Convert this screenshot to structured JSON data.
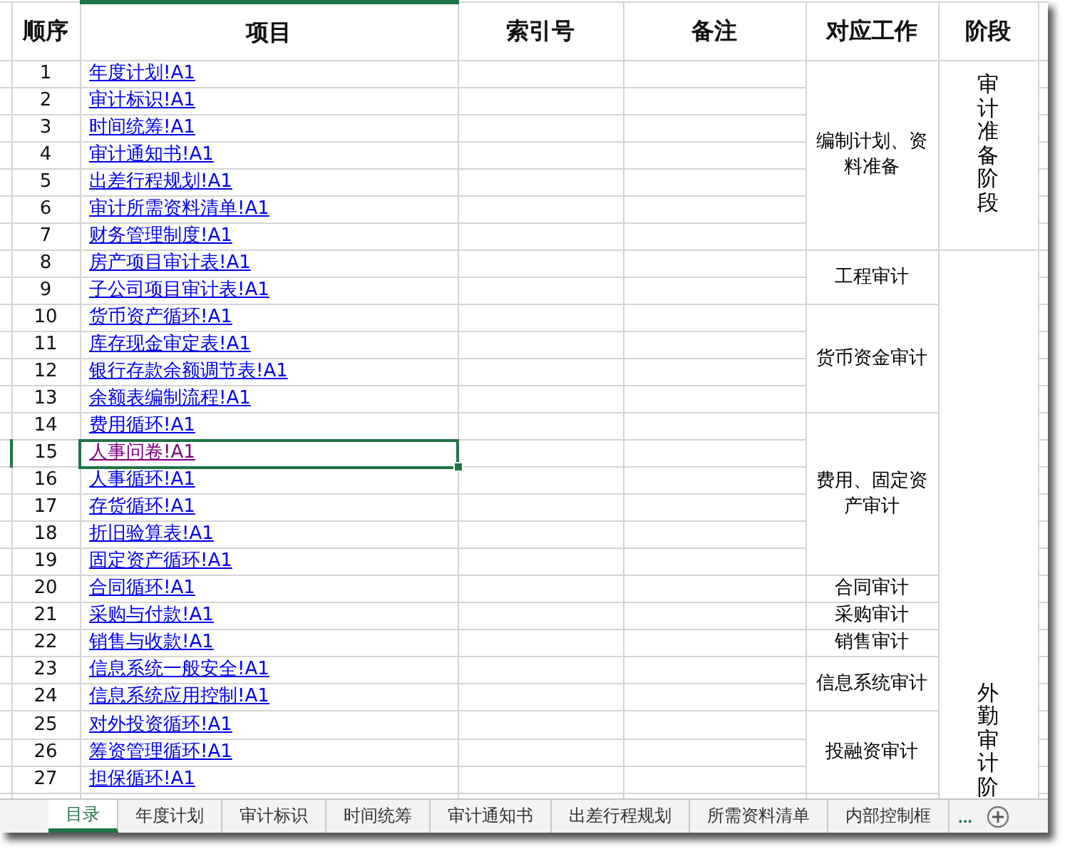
{
  "columns": [
    "顺序",
    "项目",
    "索引号",
    "备注",
    "对应工作",
    "阶段"
  ],
  "stages": [
    {
      "label": "审计准备阶段",
      "works": [
        {
          "label": "编制计划、资料准备",
          "items": [
            {
              "no": "1",
              "link": "年度计划!A1",
              "visited": false,
              "selected": false
            },
            {
              "no": "2",
              "link": "审计标识!A1",
              "visited": false,
              "selected": false
            },
            {
              "no": "3",
              "link": "时间统筹!A1",
              "visited": false,
              "selected": false
            },
            {
              "no": "4",
              "link": "审计通知书!A1",
              "visited": false,
              "selected": false
            },
            {
              "no": "5",
              "link": "出差行程规划!A1",
              "visited": false,
              "selected": false
            },
            {
              "no": "6",
              "link": "审计所需资料清单!A1",
              "visited": false,
              "selected": false
            },
            {
              "no": "7",
              "link": "财务管理制度!A1",
              "visited": false,
              "selected": false
            }
          ]
        }
      ]
    },
    {
      "label": "外勤审计阶",
      "works": [
        {
          "label": "工程审计",
          "items": [
            {
              "no": "8",
              "link": "房产项目审计表!A1",
              "visited": false,
              "selected": false
            },
            {
              "no": "9",
              "link": "子公司项目审计表!A1",
              "visited": false,
              "selected": false
            }
          ]
        },
        {
          "label": "货币资金审计",
          "items": [
            {
              "no": "10",
              "link": "货币资产循环!A1",
              "visited": false,
              "selected": false
            },
            {
              "no": "11",
              "link": "库存现金审定表!A1",
              "visited": false,
              "selected": false
            },
            {
              "no": "12",
              "link": "银行存款余额调节表!A1",
              "visited": false,
              "selected": false
            },
            {
              "no": "13",
              "link": "余额表编制流程!A1",
              "visited": false,
              "selected": false
            }
          ]
        },
        {
          "label": "费用、固定资产审计",
          "items": [
            {
              "no": "14",
              "link": "费用循环!A1",
              "visited": false,
              "selected": false
            },
            {
              "no": "15",
              "link": "人事问卷!A1",
              "visited": true,
              "selected": true
            },
            {
              "no": "16",
              "link": "人事循环!A1",
              "visited": false,
              "selected": false
            },
            {
              "no": "17",
              "link": "存货循环!A1",
              "visited": false,
              "selected": false
            },
            {
              "no": "18",
              "link": "折旧验算表!A1",
              "visited": false,
              "selected": false
            },
            {
              "no": "19",
              "link": "固定资产循环!A1",
              "visited": false,
              "selected": false
            }
          ]
        },
        {
          "label": "合同审计",
          "items": [
            {
              "no": "20",
              "link": "合同循环!A1",
              "visited": false,
              "selected": false
            }
          ]
        },
        {
          "label": "采购审计",
          "items": [
            {
              "no": "21",
              "link": "采购与付款!A1",
              "visited": false,
              "selected": false
            }
          ]
        },
        {
          "label": "销售审计",
          "items": [
            {
              "no": "22",
              "link": "销售与收款!A1",
              "visited": false,
              "selected": false
            }
          ]
        },
        {
          "label": "信息系统审计",
          "items": [
            {
              "no": "23",
              "link": "信息系统一般安全!A1",
              "visited": false,
              "selected": false
            },
            {
              "no": "24",
              "link": "信息系统应用控制!A1",
              "visited": false,
              "selected": false
            }
          ]
        },
        {
          "label": "投融资审计",
          "items": [
            {
              "no": "25",
              "link": "对外投资循环!A1",
              "visited": false,
              "selected": false
            },
            {
              "no": "26",
              "link": "筹资管理循环!A1",
              "visited": false,
              "selected": false
            },
            {
              "no": "27",
              "link": "担保循环!A1",
              "visited": false,
              "selected": false
            }
          ]
        }
      ]
    }
  ],
  "sheet_tabs": [
    {
      "label": "目录",
      "selected": true
    },
    {
      "label": "年度计划",
      "selected": false
    },
    {
      "label": "审计标识",
      "selected": false
    },
    {
      "label": "时间统筹",
      "selected": false
    },
    {
      "label": "审计通知书",
      "selected": false
    },
    {
      "label": "出差行程规划",
      "selected": false
    },
    {
      "label": "所需资料清单",
      "selected": false
    },
    {
      "label": "内部控制框",
      "selected": false
    }
  ],
  "more_tabs": "..."
}
